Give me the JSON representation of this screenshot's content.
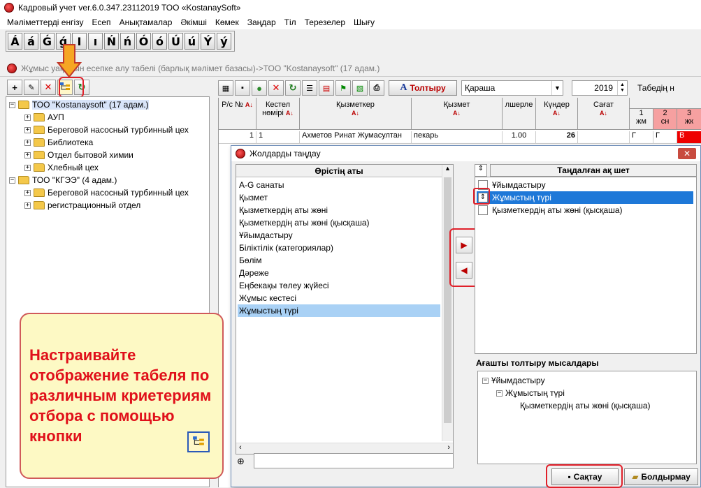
{
  "window": {
    "title": "Кадровый учет ver.6.0.347.23112019 ТОО «KostanaySoft»"
  },
  "menu": [
    "Мәліметтерді енгізу",
    "Есеп",
    "Анықтамалар",
    "Әкімші",
    "Көмек",
    "Заңдар",
    "Тіл",
    "Терезелер",
    "Шығу"
  ],
  "letters": [
    "Á",
    "á",
    "Ǵ",
    "ǵ",
    "I",
    "ı",
    "Ń",
    "ń",
    "Ó",
    "ó",
    "Ú",
    "ú",
    "Ý",
    "ý"
  ],
  "subwindow_title": "Жұмыс уақытын есепке алу табелі (барлық мәлімет базасы)->ТОО \"Kostanaysoft\" (17 адам.)",
  "tree": {
    "root1": "ТОО \"Kostanaysoft\" (17 адам.)",
    "root1_children": [
      "АУП",
      "Береговой насосный турбинный цех",
      "Библиотека",
      "Отдел бытовой химии",
      "Хлебный цех"
    ],
    "root2": "ТОО \"КГЭЭ\" (4 адам.)",
    "root2_children": [
      "Береговой насосный турбинный цех",
      "регистрационный отдел"
    ]
  },
  "right_toolbar": {
    "fill_label": "Толтыру",
    "month": "Қараша",
    "year": "2019",
    "tabel_label": "Табедің н"
  },
  "grid": {
    "headers": {
      "no": "Р/с №",
      "tabel": "Кестел нөмірі",
      "employee": "Қызметкер",
      "position": "Қызмет",
      "rate": "лшерле",
      "days": "Күндер",
      "hours": "Сағат"
    },
    "day_headers": [
      {
        "num": "1",
        "dow": "жм"
      },
      {
        "num": "2",
        "dow": "сн"
      },
      {
        "num": "3",
        "dow": "жк"
      }
    ],
    "row": {
      "no": "1",
      "tabel": "1",
      "employee": "Ахметов Ринат Жумасултан",
      "position": "пекарь",
      "rate": "1.00",
      "days": "26",
      "d1": "Г",
      "d2": "Г",
      "d3": "В"
    }
  },
  "dialog": {
    "title": "Жолдарды таңдау",
    "left_header": "Өрістің аты",
    "fields": [
      "A-G санаты",
      "Қызмет",
      "Қызметкердің аты жөні",
      "Қызметкердің аты жөні (қысқаша)",
      "Ұйымдастыру",
      "Біліктілік (категориялар)",
      "Бөлім",
      "Дәреже",
      "Еңбекақы төлеу жүйесі",
      "Жұмыс кестесі",
      "Жұмыстың түрі"
    ],
    "selected_field_index": 10,
    "right_header": "Таңдалған ақ шет",
    "chosen": [
      "Ұйымдастыру",
      "Жұмыстың түрі",
      "Қызметкердің аты жөні (қысқаша)"
    ],
    "example_label": "Ағашты толтыру мысалдары",
    "example_tree": [
      "Ұйымдастыру",
      "Жұмыстың түрі",
      "Қызметкердің аты жөні (қысқаша)"
    ],
    "save_label": "Сақтау",
    "cancel_label": "Болдырмау"
  },
  "callout": {
    "text": "Настраивайте отображение табеля по различным криетериям отбора с помощью кнопки"
  }
}
